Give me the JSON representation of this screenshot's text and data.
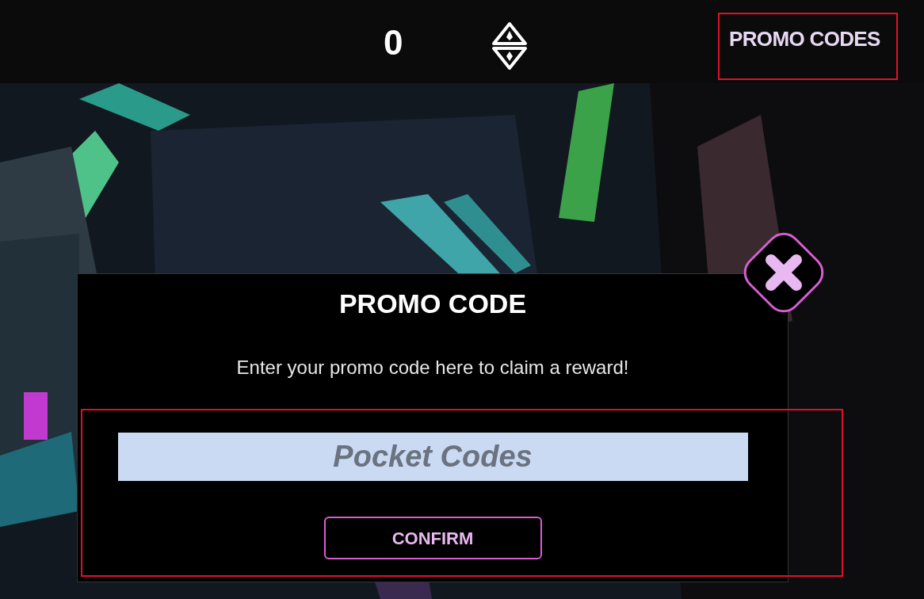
{
  "top_bar": {
    "currency_amount": "0",
    "promo_codes_button": "PROMO CODES"
  },
  "dialog": {
    "title": "PROMO CODE",
    "message": "Enter your promo code here to claim a reward!",
    "input": {
      "placeholder": "Pocket Codes"
    },
    "confirm_button": "CONFIRM"
  }
}
